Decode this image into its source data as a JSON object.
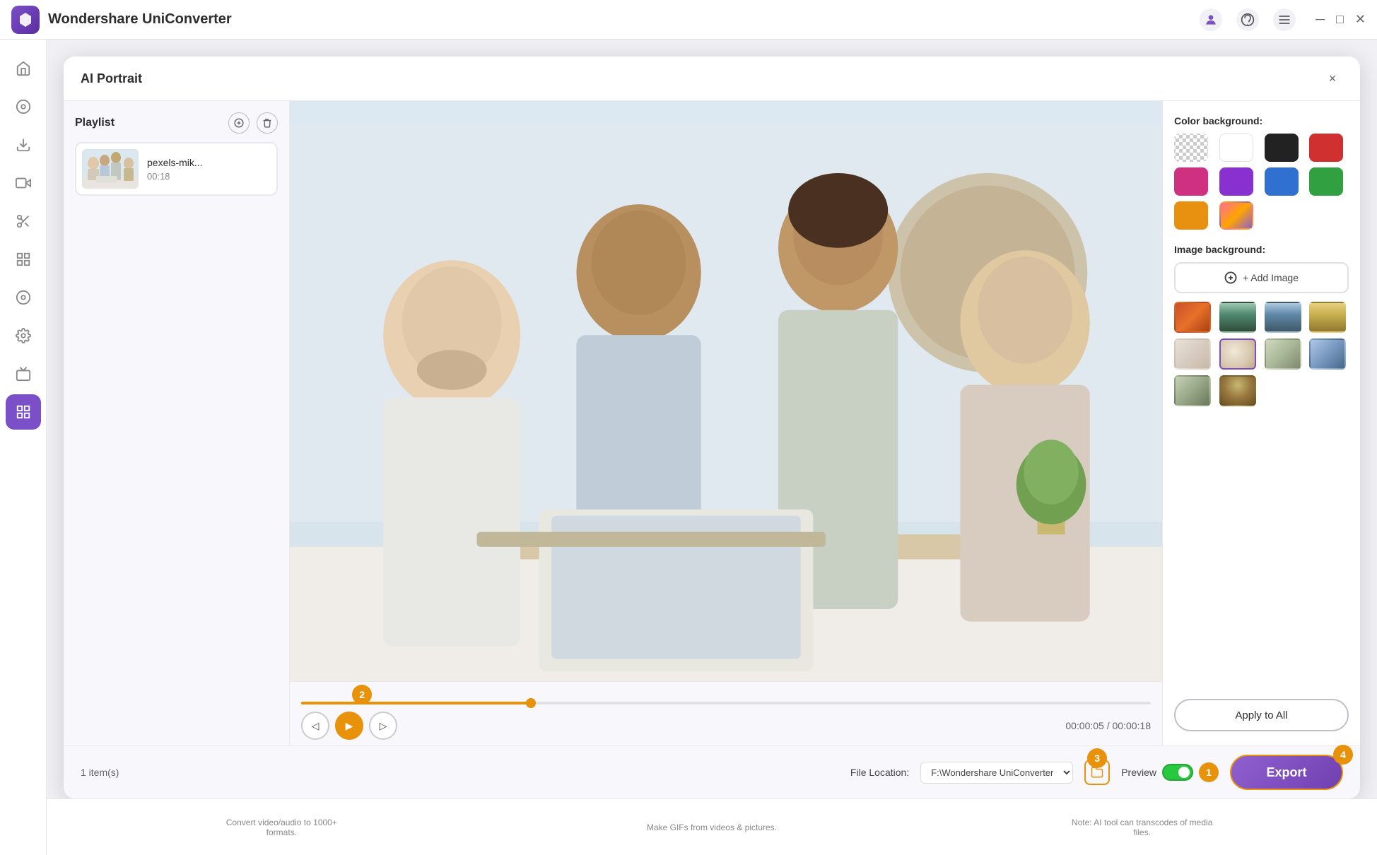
{
  "app": {
    "title": "Wondershare UniConverter",
    "logo_color": "#7b4fc8"
  },
  "titlebar": {
    "controls": [
      "user-icon",
      "headset-icon",
      "menu-icon",
      "minimize-icon",
      "maximize-icon",
      "close-icon"
    ]
  },
  "dialog": {
    "title": "AI Portrait",
    "close_label": "×"
  },
  "playlist": {
    "title": "Playlist",
    "add_tooltip": "Add",
    "delete_tooltip": "Delete",
    "items": [
      {
        "name": "pexels-mik...",
        "duration": "00:18",
        "thumb": "people"
      }
    ],
    "item_count_label": "1 item(s)"
  },
  "video": {
    "current_time": "00:00:05",
    "total_time": "00:00:18",
    "progress_percent": 27,
    "step_badge_2": "2"
  },
  "right_panel": {
    "color_bg_label": "Color background:",
    "colors": [
      {
        "id": "checkered",
        "value": "transparent",
        "label": "Transparent"
      },
      {
        "id": "white",
        "value": "#ffffff",
        "label": "White"
      },
      {
        "id": "black",
        "value": "#222222",
        "label": "Black"
      },
      {
        "id": "red",
        "value": "#d03030",
        "label": "Red"
      },
      {
        "id": "pink",
        "value": "#d03080",
        "label": "Pink"
      },
      {
        "id": "purple",
        "value": "#8830d0",
        "label": "Purple"
      },
      {
        "id": "blue",
        "value": "#3070d0",
        "label": "Blue"
      },
      {
        "id": "green",
        "value": "#30a040",
        "label": "Green"
      },
      {
        "id": "orange",
        "value": "#e89010",
        "label": "Orange"
      },
      {
        "id": "gradient",
        "value": "gradient",
        "label": "Gradient"
      }
    ],
    "image_bg_label": "Image background:",
    "add_image_label": "+ Add Image",
    "images": [
      {
        "id": "img1",
        "class": "img-bg-1"
      },
      {
        "id": "img2",
        "class": "img-bg-2"
      },
      {
        "id": "img3",
        "class": "img-bg-3"
      },
      {
        "id": "img4",
        "class": "img-bg-4"
      },
      {
        "id": "img5",
        "class": "img-bg-5"
      },
      {
        "id": "img6",
        "class": "img-bg-6",
        "selected": true
      },
      {
        "id": "img7",
        "class": "img-bg-7"
      },
      {
        "id": "img8",
        "class": "img-bg-8"
      },
      {
        "id": "img9",
        "class": "img-bg-9"
      },
      {
        "id": "img10",
        "class": "img-bg-10"
      }
    ],
    "apply_all_label": "Apply to All",
    "step_badge_4": "4"
  },
  "footer": {
    "file_location_label": "File Location:",
    "file_path": "F:\\Wondershare UniConverter",
    "preview_label": "Preview",
    "preview_on": true,
    "step_badge_3": "3",
    "step_badge_1": "1",
    "export_label": "Export"
  },
  "sidebar": {
    "items": [
      {
        "id": "home",
        "icon": "⌂",
        "label": "Home"
      },
      {
        "id": "convert",
        "icon": "↓",
        "label": "Convert"
      },
      {
        "id": "download",
        "icon": "⬇",
        "label": "Download"
      },
      {
        "id": "video-editor",
        "icon": "▶",
        "label": "Video Editor"
      },
      {
        "id": "trim",
        "icon": "✂",
        "label": "Trim"
      },
      {
        "id": "merge",
        "icon": "⊞",
        "label": "Merge"
      },
      {
        "id": "screen-record",
        "icon": "⊙",
        "label": "Screen Record"
      },
      {
        "id": "settings",
        "icon": "⚙",
        "label": "Settings"
      },
      {
        "id": "tv",
        "icon": "📺",
        "label": "TV"
      },
      {
        "id": "toolbox",
        "icon": "⊞",
        "label": "Toolbox",
        "active": true
      }
    ]
  },
  "feature_strip": {
    "items": [
      {
        "text": "Convert video/audio to 1000+ formats."
      },
      {
        "text": "Make GIFs from videos & pictures."
      },
      {
        "text": "Note: AI tool can transcodes of media files."
      }
    ]
  }
}
